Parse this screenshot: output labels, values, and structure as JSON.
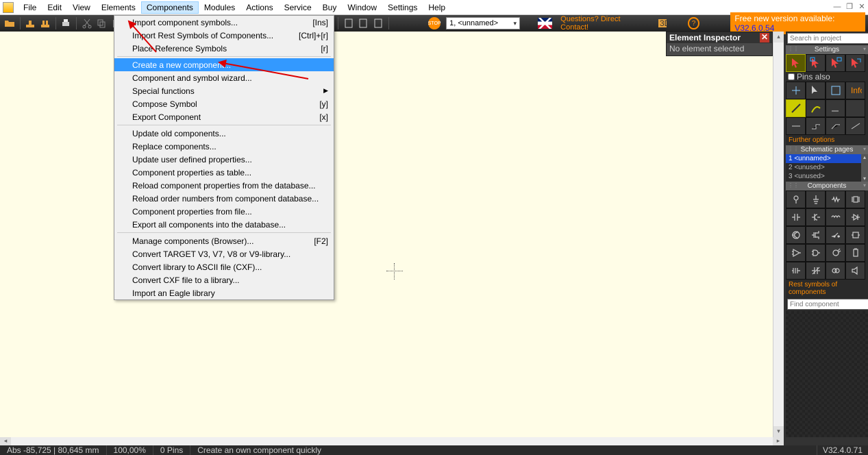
{
  "menu": {
    "items": [
      "File",
      "Edit",
      "View",
      "Elements",
      "Components",
      "Modules",
      "Actions",
      "Service",
      "Buy",
      "Window",
      "Settings",
      "Help"
    ],
    "open": "Components"
  },
  "winbtns": {
    "min": "—",
    "max": "❐",
    "close": "✕"
  },
  "toolbar": {
    "page": "1, <unnamed>",
    "contact": "Questions? Direct Contact!",
    "version_prefix": "Free new version available: ",
    "version": "V32.6.0.54"
  },
  "dropdown": [
    {
      "label": "Import component symbols...",
      "sc": "[Ins]"
    },
    {
      "label": "Import Rest Symbols of Components...",
      "sc": "[Ctrl]+[r]"
    },
    {
      "label": "Place Reference Symbols",
      "sc": "[r]"
    },
    {
      "sep": true
    },
    {
      "label": "Create a new component...",
      "hl": true
    },
    {
      "label": "Component and symbol wizard..."
    },
    {
      "label": "Special functions",
      "sub": true
    },
    {
      "label": "Compose Symbol",
      "sc": "[y]"
    },
    {
      "label": "Export Component",
      "sc": "[x]"
    },
    {
      "sep": true
    },
    {
      "label": "Update old components..."
    },
    {
      "label": "Replace components..."
    },
    {
      "label": "Update user defined properties..."
    },
    {
      "label": "Component properties as table..."
    },
    {
      "label": "Reload component properties from the database..."
    },
    {
      "label": "Reload order numbers from component database..."
    },
    {
      "label": "Component properties from file..."
    },
    {
      "label": "Export all components into the database..."
    },
    {
      "sep": true
    },
    {
      "label": "Manage components (Browser)...",
      "sc": "[F2]"
    },
    {
      "label": "Convert TARGET V3, V7, V8 or V9-library..."
    },
    {
      "label": "Convert library to ASCII file (CXF)..."
    },
    {
      "label": "Convert CXF file to a library..."
    },
    {
      "label": "Import an Eagle library"
    }
  ],
  "inspector": {
    "title": "Element Inspector",
    "msg": "No element selected"
  },
  "right": {
    "search_ph": "Search in project",
    "hdr_settings": "Settings",
    "pins_also": "Pins also",
    "further": "Further options",
    "hdr_pages": "Schematic pages",
    "pages": [
      "1 <unnamed>",
      "2 <unused>",
      "3 <unused>"
    ],
    "hdr_components": "Components",
    "rest": "Rest symbols of components",
    "find_ph": "Find component"
  },
  "status": {
    "coords": "Abs -85,725 | 80,645 mm",
    "zoom": "100,00%",
    "pins": "0 Pins",
    "hint": "Create an own component quickly",
    "ver": "V32.4.0.71"
  }
}
